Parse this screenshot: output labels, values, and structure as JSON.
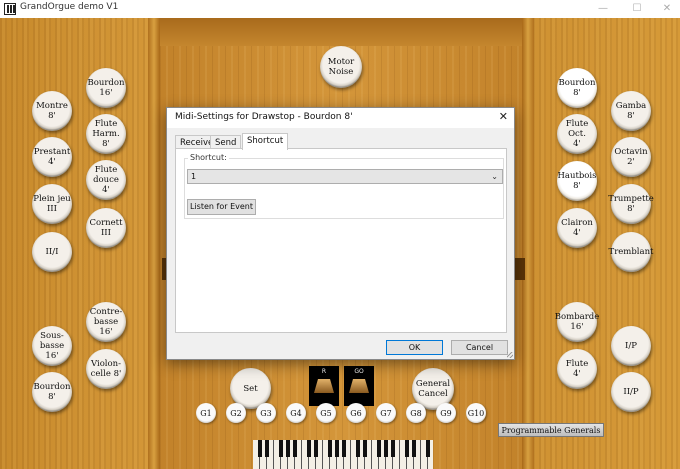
{
  "window": {
    "title": "GrandOrgue demo V1",
    "minimize_glyph": "—",
    "maximize_glyph": "☐",
    "close_glyph": "✕"
  },
  "left_stops": [
    {
      "label": "Bourdon\n16'"
    },
    {
      "label": "Montre\n8'"
    },
    {
      "label": "Flute\nHarm.\n8'"
    },
    {
      "label": "Prestant\n4'"
    },
    {
      "label": "Flute\ndouce\n4'"
    },
    {
      "label": "Plein jeu\nIII"
    },
    {
      "label": "Cornett\nIII"
    },
    {
      "label": "II/I"
    },
    {
      "label": "Contre-\nbasse\n16'"
    },
    {
      "label": "Sous-\nbasse\n16'"
    },
    {
      "label": "Violon-\ncelle 8'"
    },
    {
      "label": "Bourdon\n8'"
    }
  ],
  "right_stops": [
    {
      "label": "Bourdon\n8'",
      "on": true
    },
    {
      "label": "Gamba 8'"
    },
    {
      "label": "Flute\nOct.\n4'"
    },
    {
      "label": "Octavin\n2'"
    },
    {
      "label": "Hautbois\n8'",
      "on": true
    },
    {
      "label": "Trumpette\n8'"
    },
    {
      "label": "Clairon 4'"
    },
    {
      "label": "Tremblant"
    },
    {
      "label": "Bombarde\n16'"
    },
    {
      "label": "I/P"
    },
    {
      "label": "Flute\n4'"
    },
    {
      "label": "II/P"
    }
  ],
  "center": {
    "motor_noise": "Motor\nNoise",
    "set": "Set",
    "general_cancel": "General\nCancel",
    "swell_left_label": "R",
    "swell_right_label": "GO"
  },
  "generals": [
    "G1",
    "G2",
    "G3",
    "G4",
    "G5",
    "G6",
    "G7",
    "G8",
    "G9",
    "G10"
  ],
  "programmable_generals": "Programmable Generals",
  "dialog": {
    "title": "Midi-Settings for Drawstop - Bourdon 8'",
    "close_glyph": "✕",
    "tabs": [
      {
        "label": "Receive",
        "active": false
      },
      {
        "label": "Send",
        "active": false
      },
      {
        "label": "Shortcut",
        "active": true
      }
    ],
    "shortcut_group_label": "Shortcut:",
    "shortcut_value": "1",
    "dropdown_glyph": "⌄",
    "listen_button": "Listen for Event",
    "ok_button": "OK",
    "cancel_button": "Cancel"
  }
}
